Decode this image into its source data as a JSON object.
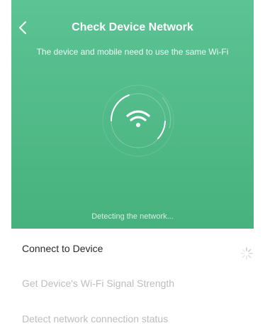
{
  "header": {
    "title": "Check Device Network",
    "subtitle": "The device and mobile need to use the same Wi-Fi",
    "status_text": "Detecting the network...",
    "back_icon": "chevron-left-icon",
    "center_icon": "wifi-icon",
    "background_color": "#4fb884"
  },
  "steps": [
    {
      "label": "Connect to Device",
      "state": "in-progress",
      "indicator_icon": "loading-spinner-icon"
    },
    {
      "label": "Get Device's Wi-Fi Signal Strength",
      "state": "pending"
    },
    {
      "label": "Detect network connection status",
      "state": "pending"
    }
  ],
  "colors": {
    "accent_green": "#4fb884",
    "active_text": "#2b2b2b",
    "pending_text": "#bdbdbd"
  }
}
